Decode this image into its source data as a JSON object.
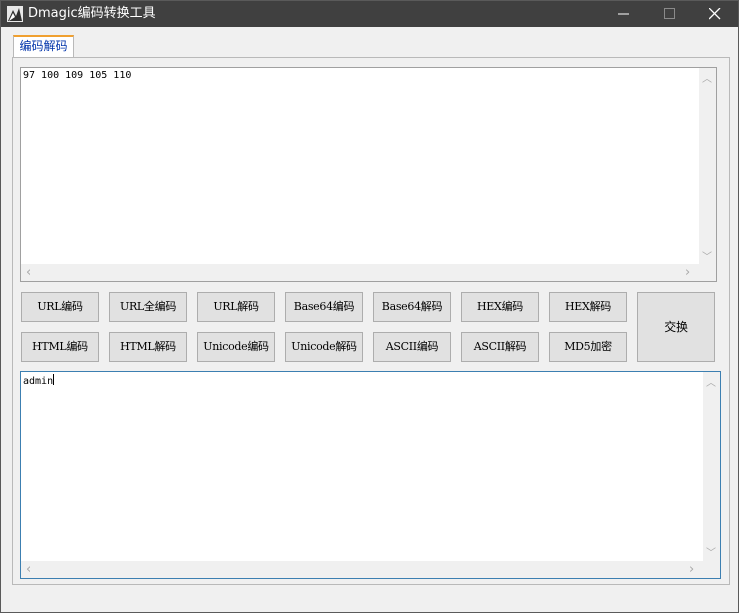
{
  "window": {
    "title": "Dmagic编码转换工具",
    "controls": {
      "minimize": "—",
      "maximize": "☐",
      "close": "✕"
    }
  },
  "tabs": [
    {
      "label": "编码解码",
      "active": true
    }
  ],
  "input": {
    "value": "97 100 109 105 110"
  },
  "output": {
    "value": "admin"
  },
  "buttons": {
    "url_encode": "URL编码",
    "url_full_encode": "URL全编码",
    "url_decode": "URL解码",
    "base64_encode": "Base64编码",
    "base64_decode": "Base64解码",
    "hex_encode": "HEX编码",
    "hex_decode": "HEX解码",
    "swap": "交换",
    "html_encode": "HTML编码",
    "html_decode": "HTML解码",
    "unicode_encode": "Unicode编码",
    "unicode_decode": "Unicode解码",
    "ascii_encode": "ASCII编码",
    "ascii_decode": "ASCII解码",
    "md5_encrypt": "MD5加密"
  },
  "scroll_arrows": {
    "up": "︿",
    "down": "﹀",
    "left": "‹",
    "right": "›"
  },
  "colors": {
    "titlebar": "#404040",
    "tab_accent": "#f0a030",
    "focus_border": "#3c7fb1"
  }
}
